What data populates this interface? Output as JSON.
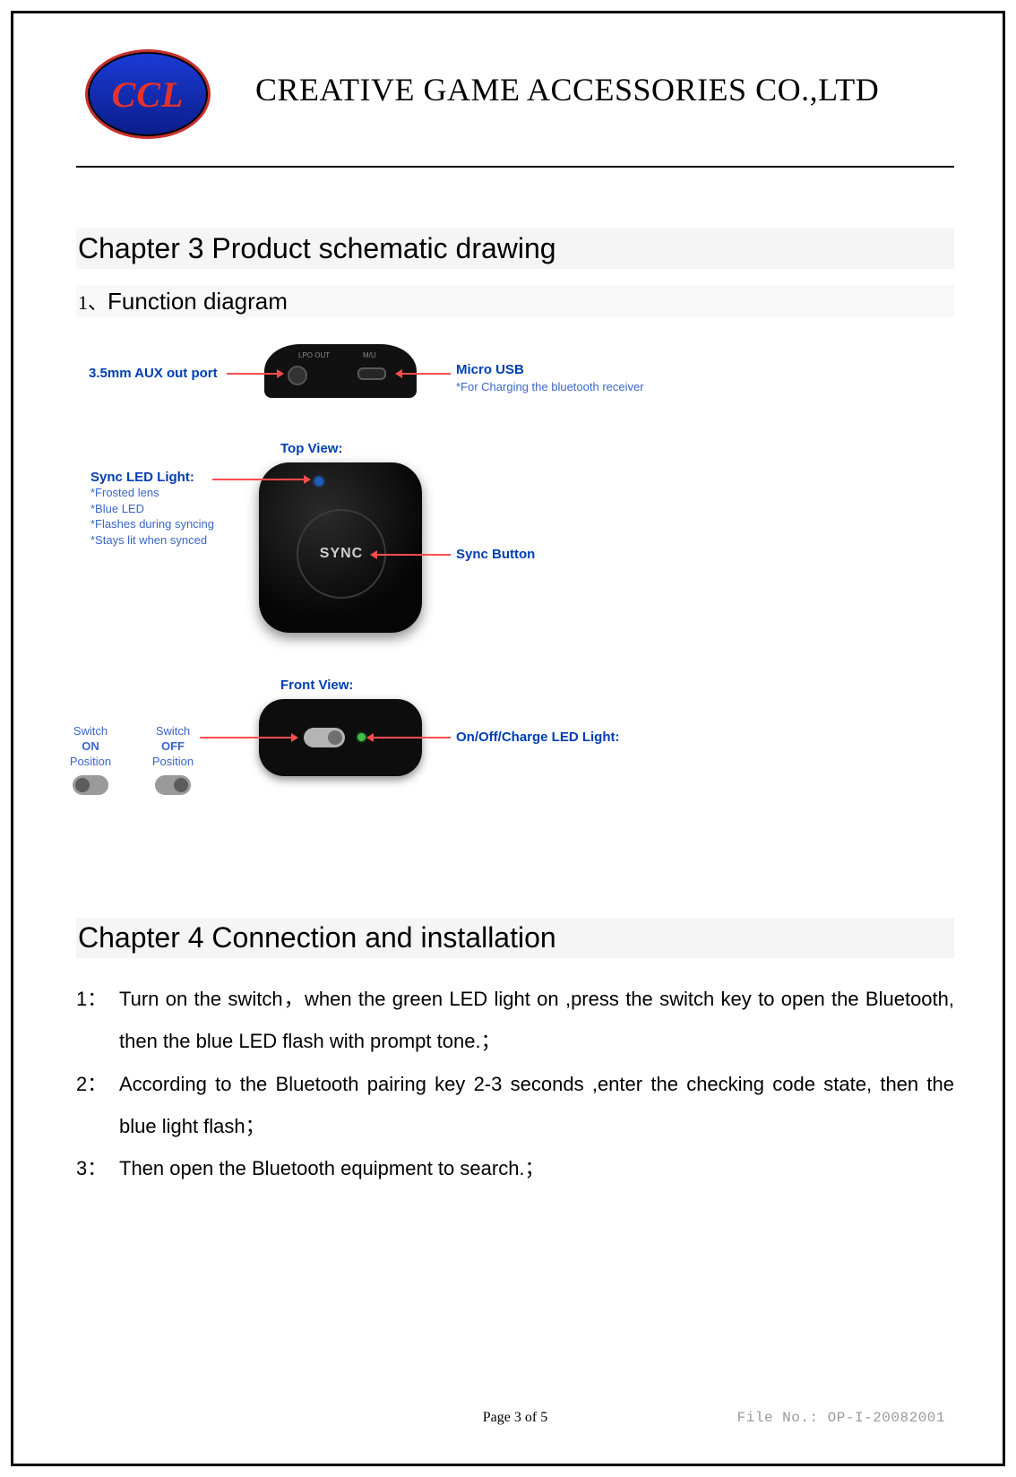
{
  "header": {
    "logo_text": "CCL",
    "company": "CREATIVE GAME ACCESSORIES    CO.,LTD"
  },
  "chapter3": {
    "title": "Chapter 3 Product schematic drawing",
    "section1_num": "1、",
    "section1_label": "Function diagram"
  },
  "diagram": {
    "aux_label": "3.5mm AUX out port",
    "port_lbl_left": "LPO OUT",
    "port_lbl_right": "M/U",
    "usb_label": "Micro USB",
    "usb_sub": "*For Charging the bluetooth receiver",
    "top_view": "Top View:",
    "sync_led_title": "Sync LED Light:",
    "sync_led_lines": [
      "*Frosted lens",
      "*Blue LED",
      "*Flashes during syncing",
      "*Stays lit when synced"
    ],
    "sync_text": "SYNC",
    "sync_button": "Sync Button",
    "front_view": "Front View:",
    "onoff_label": "On/Off/Charge LED Light:",
    "switch_on_l1": "Switch",
    "switch_on_l2": "ON",
    "switch_on_l3": "Position",
    "switch_off_l1": "Switch",
    "switch_off_l2": "OFF",
    "switch_off_l3": "Position"
  },
  "chapter4": {
    "title": "Chapter 4 Connection and installation",
    "items": [
      {
        "num": "1：",
        "text": " Turn on the switch，when the green LED light on ,press the switch key to open the Bluetooth, then the blue LED flash with prompt tone.；"
      },
      {
        "num": "2：",
        "text": " According to the Bluetooth pairing key 2-3 seconds ,enter the checking code state, then the blue light flash；"
      },
      {
        "num": "3：",
        "text": "Then open the Bluetooth equipment to search.；"
      }
    ]
  },
  "footer": {
    "page": "Page 3 of 5",
    "file": "File No.: OP-I-20082001"
  }
}
